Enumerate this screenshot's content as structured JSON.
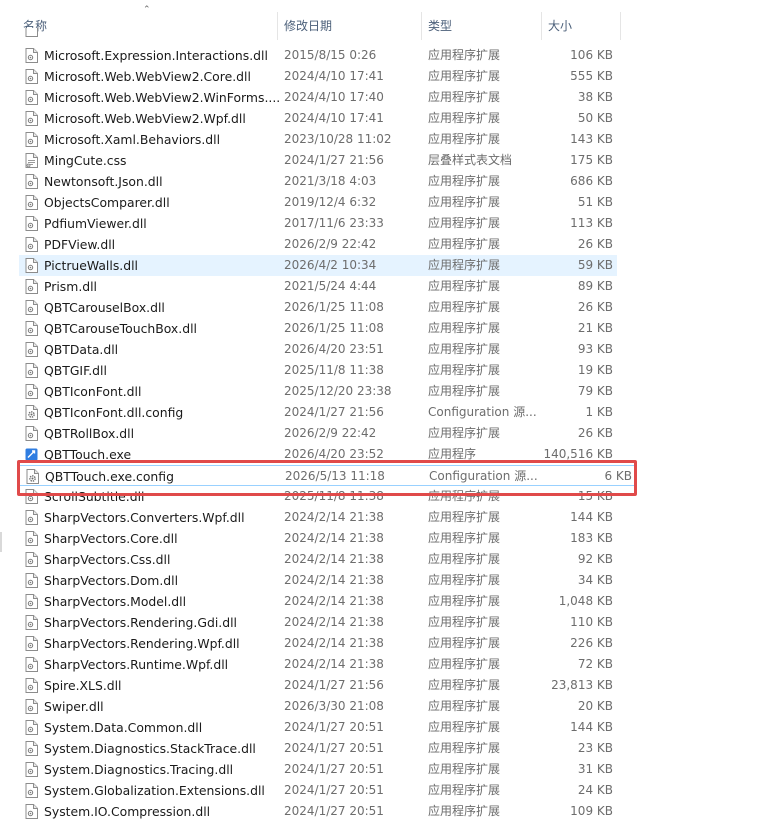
{
  "columns": {
    "name": "名称",
    "date": "修改日期",
    "type": "类型",
    "size": "大小"
  },
  "icons": {
    "dll": "dll-file-icon",
    "css": "css-file-icon",
    "config": "config-file-icon",
    "exe": "exe-app-icon"
  },
  "colors": {
    "hover_background": "#e5f3ff",
    "selection_border": "#99d1ff",
    "annotation_box": "#e04a4a",
    "header_text": "#4c607a"
  },
  "files": [
    {
      "name": "Microsoft.Expression.Interactions.dll",
      "date": "2015/8/15 0:26",
      "type": "应用程序扩展",
      "size": "106 KB",
      "icon": "dll"
    },
    {
      "name": "Microsoft.Web.WebView2.Core.dll",
      "date": "2024/4/10 17:41",
      "type": "应用程序扩展",
      "size": "555 KB",
      "icon": "dll"
    },
    {
      "name": "Microsoft.Web.WebView2.WinForms....",
      "date": "2024/4/10 17:40",
      "type": "应用程序扩展",
      "size": "38 KB",
      "icon": "dll"
    },
    {
      "name": "Microsoft.Web.WebView2.Wpf.dll",
      "date": "2024/4/10 17:41",
      "type": "应用程序扩展",
      "size": "50 KB",
      "icon": "dll"
    },
    {
      "name": "Microsoft.Xaml.Behaviors.dll",
      "date": "2023/10/28 11:02",
      "type": "应用程序扩展",
      "size": "143 KB",
      "icon": "dll"
    },
    {
      "name": "MingCute.css",
      "date": "2024/1/27 21:56",
      "type": "层叠样式表文档",
      "size": "175 KB",
      "icon": "css"
    },
    {
      "name": "Newtonsoft.Json.dll",
      "date": "2021/3/18 4:03",
      "type": "应用程序扩展",
      "size": "686 KB",
      "icon": "dll"
    },
    {
      "name": "ObjectsComparer.dll",
      "date": "2019/12/4 6:32",
      "type": "应用程序扩展",
      "size": "51 KB",
      "icon": "dll"
    },
    {
      "name": "PdfiumViewer.dll",
      "date": "2017/11/6 23:33",
      "type": "应用程序扩展",
      "size": "113 KB",
      "icon": "dll"
    },
    {
      "name": "PDFView.dll",
      "date": "2026/2/9 22:42",
      "type": "应用程序扩展",
      "size": "26 KB",
      "icon": "dll"
    },
    {
      "name": "PictrueWalls.dll",
      "date": "2026/4/2 10:34",
      "type": "应用程序扩展",
      "size": "59 KB",
      "icon": "dll",
      "state": "hover"
    },
    {
      "name": "Prism.dll",
      "date": "2021/5/24 4:44",
      "type": "应用程序扩展",
      "size": "89 KB",
      "icon": "dll"
    },
    {
      "name": "QBTCarouselBox.dll",
      "date": "2026/1/25 11:08",
      "type": "应用程序扩展",
      "size": "26 KB",
      "icon": "dll"
    },
    {
      "name": "QBTCarouseTouchBox.dll",
      "date": "2026/1/25 11:08",
      "type": "应用程序扩展",
      "size": "21 KB",
      "icon": "dll"
    },
    {
      "name": "QBTData.dll",
      "date": "2026/4/20 23:51",
      "type": "应用程序扩展",
      "size": "93 KB",
      "icon": "dll"
    },
    {
      "name": "QBTGIF.dll",
      "date": "2025/11/8 11:38",
      "type": "应用程序扩展",
      "size": "19 KB",
      "icon": "dll"
    },
    {
      "name": "QBTIconFont.dll",
      "date": "2025/12/20 23:38",
      "type": "应用程序扩展",
      "size": "79 KB",
      "icon": "dll"
    },
    {
      "name": "QBTIconFont.dll.config",
      "date": "2024/1/27 21:56",
      "type": "Configuration 源...",
      "size": "1 KB",
      "icon": "config"
    },
    {
      "name": "QBTRollBox.dll",
      "date": "2026/2/9 22:42",
      "type": "应用程序扩展",
      "size": "26 KB",
      "icon": "dll"
    },
    {
      "name": "QBTTouch.exe",
      "date": "2026/4/20 23:52",
      "type": "应用程序",
      "size": "140,516 KB",
      "icon": "exe"
    },
    {
      "name": "QBTTouch.exe.config",
      "date": "2026/5/13 11:18",
      "type": "Configuration 源...",
      "size": "6 KB",
      "icon": "config",
      "state": "selected"
    },
    {
      "name": "ScrollSubtitle.dll",
      "date": "2025/11/8 11:38",
      "type": "应用程序扩展",
      "size": "15 KB",
      "icon": "dll"
    },
    {
      "name": "SharpVectors.Converters.Wpf.dll",
      "date": "2024/2/14 21:38",
      "type": "应用程序扩展",
      "size": "144 KB",
      "icon": "dll"
    },
    {
      "name": "SharpVectors.Core.dll",
      "date": "2024/2/14 21:38",
      "type": "应用程序扩展",
      "size": "183 KB",
      "icon": "dll"
    },
    {
      "name": "SharpVectors.Css.dll",
      "date": "2024/2/14 21:38",
      "type": "应用程序扩展",
      "size": "92 KB",
      "icon": "dll"
    },
    {
      "name": "SharpVectors.Dom.dll",
      "date": "2024/2/14 21:38",
      "type": "应用程序扩展",
      "size": "34 KB",
      "icon": "dll"
    },
    {
      "name": "SharpVectors.Model.dll",
      "date": "2024/2/14 21:38",
      "type": "应用程序扩展",
      "size": "1,048 KB",
      "icon": "dll"
    },
    {
      "name": "SharpVectors.Rendering.Gdi.dll",
      "date": "2024/2/14 21:38",
      "type": "应用程序扩展",
      "size": "110 KB",
      "icon": "dll"
    },
    {
      "name": "SharpVectors.Rendering.Wpf.dll",
      "date": "2024/2/14 21:38",
      "type": "应用程序扩展",
      "size": "226 KB",
      "icon": "dll"
    },
    {
      "name": "SharpVectors.Runtime.Wpf.dll",
      "date": "2024/2/14 21:38",
      "type": "应用程序扩展",
      "size": "72 KB",
      "icon": "dll"
    },
    {
      "name": "Spire.XLS.dll",
      "date": "2024/1/27 21:56",
      "type": "应用程序扩展",
      "size": "23,813 KB",
      "icon": "dll"
    },
    {
      "name": "Swiper.dll",
      "date": "2026/3/30 21:08",
      "type": "应用程序扩展",
      "size": "20 KB",
      "icon": "dll"
    },
    {
      "name": "System.Data.Common.dll",
      "date": "2024/1/27 20:51",
      "type": "应用程序扩展",
      "size": "144 KB",
      "icon": "dll"
    },
    {
      "name": "System.Diagnostics.StackTrace.dll",
      "date": "2024/1/27 20:51",
      "type": "应用程序扩展",
      "size": "23 KB",
      "icon": "dll"
    },
    {
      "name": "System.Diagnostics.Tracing.dll",
      "date": "2024/1/27 20:51",
      "type": "应用程序扩展",
      "size": "31 KB",
      "icon": "dll"
    },
    {
      "name": "System.Globalization.Extensions.dll",
      "date": "2024/1/27 20:51",
      "type": "应用程序扩展",
      "size": "24 KB",
      "icon": "dll"
    },
    {
      "name": "System.IO.Compression.dll",
      "date": "2024/1/27 20:51",
      "type": "应用程序扩展",
      "size": "109 KB",
      "icon": "dll"
    }
  ]
}
